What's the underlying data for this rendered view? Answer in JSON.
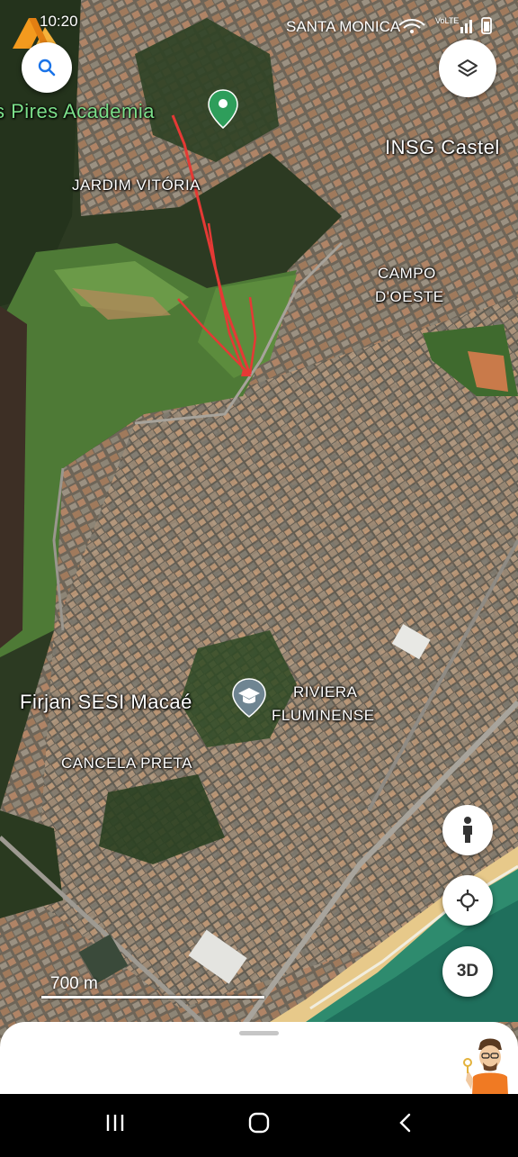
{
  "status_bar": {
    "time": "10:20",
    "region": "SANTA MONICA",
    "network": "VoLTE"
  },
  "map": {
    "labels": {
      "academia": "s Pires Academia",
      "jardim": "JARDIM VITÓRIA",
      "insg": "INSG Castel",
      "campo_line1": "CAMPO",
      "campo_line2": "D'OESTE",
      "firjan": "Firjan SESI Macaé",
      "riviera_line1": "RIVIERA",
      "riviera_line2": "FLUMINENSE",
      "cancela": "CANCELA PRETA"
    },
    "scale_text": "700 m"
  },
  "controls": {
    "search_icon": "search-icon",
    "layers_icon": "layers-icon",
    "pegman_icon": "pegman-icon",
    "location_icon": "my-location-icon",
    "three_d_label": "3D"
  },
  "colors": {
    "accent_pin": "#2E9E5B",
    "route_red": "#E53935",
    "poi_green": "#7CE08A"
  }
}
